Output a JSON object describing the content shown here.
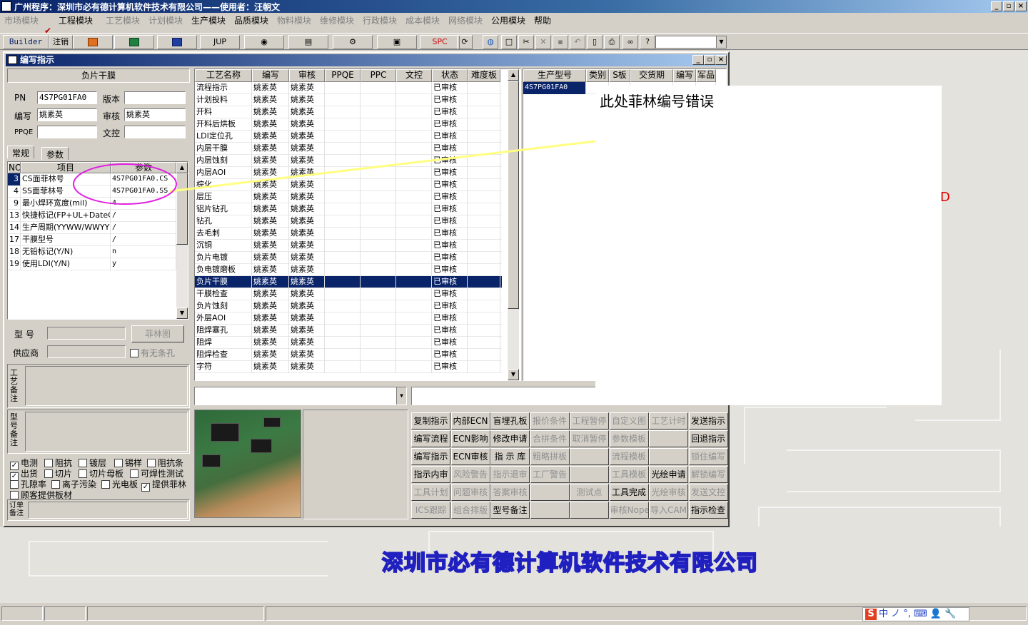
{
  "app": {
    "title": "广州程序：深圳市必有德计算机软件技术有限公司——使用者：汪朝文",
    "win_min": "_",
    "win_max": "▫",
    "win_close": "×"
  },
  "menu": [
    {
      "label": "市场模块",
      "enabled": false
    },
    {
      "label": "工程模块",
      "enabled": true,
      "checked": true
    },
    {
      "label": "工艺模块",
      "enabled": false
    },
    {
      "label": "计划模块",
      "enabled": false
    },
    {
      "label": "生产模块",
      "enabled": true
    },
    {
      "label": "品质模块",
      "enabled": true
    },
    {
      "label": "物料模块",
      "enabled": false
    },
    {
      "label": "维修模块",
      "enabled": false
    },
    {
      "label": "行政模块",
      "enabled": false
    },
    {
      "label": "成本模块",
      "enabled": false
    },
    {
      "label": "网络模块",
      "enabled": false
    },
    {
      "label": "公用模块",
      "enabled": true
    },
    {
      "label": "帮助",
      "enabled": true
    }
  ],
  "toolbar": {
    "builder": "Builder",
    "logout": "注销",
    "jup": "JUP",
    "spc": "SPC"
  },
  "child": {
    "title": "编写指示",
    "left": {
      "panel_title": "负片干膜",
      "pn_label": "PN",
      "pn_value": "4S7PG01FA0",
      "version_label": "版本",
      "version_value": "",
      "writer_label": "编写",
      "writer_value": "姚素英",
      "reviewer_label": "审核",
      "reviewer_value": "姚素英",
      "ppqe_label": "PPQE",
      "ppqe_value": "",
      "doc_label": "文控",
      "doc_value": "",
      "tab_general": "常规",
      "tab_params": "参数",
      "grid_headers": [
        "NO",
        "项目",
        "参数"
      ],
      "grid_rows": [
        {
          "no": "3",
          "item": "CS面菲林号",
          "param": "4S7PG01FA0.CS"
        },
        {
          "no": "4",
          "item": "SS面菲林号",
          "param": "4S7PG01FA0.SS"
        },
        {
          "no": "9",
          "item": "最小焊环宽度(mil)",
          "param": "4"
        },
        {
          "no": "13",
          "item": "快捷标记(FP+UL+DateC",
          "param": "/"
        },
        {
          "no": "14",
          "item": "生产周期(YYWW/WWYY)",
          "param": "/"
        },
        {
          "no": "17",
          "item": "干膜型号",
          "param": "/"
        },
        {
          "no": "18",
          "item": "无铅标记(Y/N)",
          "param": "n"
        },
        {
          "no": "19",
          "item": "使用LDI(Y/N)",
          "param": "y"
        }
      ],
      "model_label": "型  号",
      "model_value": "",
      "film_button": "菲林图",
      "supplier_label": "供应商",
      "supplier_value": "",
      "has_slot_label": "有无条孔",
      "process_note_label": "工艺备注",
      "model_note_label": "型号备注",
      "checkboxes": [
        {
          "label": "电测",
          "checked": true
        },
        {
          "label": "阻抗",
          "checked": false
        },
        {
          "label": "镀层",
          "checked": false
        },
        {
          "label": "锡样",
          "checked": false
        },
        {
          "label": "阻抗条",
          "checked": false
        },
        {
          "label": "出货",
          "checked": true
        },
        {
          "label": "切片",
          "checked": false
        },
        {
          "label": "切片母板",
          "checked": false
        },
        {
          "label": "可焊性测试",
          "checked": false
        },
        {
          "label": "孔隙率",
          "checked": false
        },
        {
          "label": "离子污染",
          "checked": false
        },
        {
          "label": "光电板",
          "checked": false
        },
        {
          "label": "提供菲林",
          "checked": true
        },
        {
          "label": "顾客提供板材",
          "checked": false
        }
      ],
      "order_note_label": "订单备注"
    },
    "process": {
      "headers": [
        "工艺名称",
        "编写",
        "审核",
        "PPQE",
        "PPC",
        "文控",
        "状态",
        "难度板"
      ],
      "rows": [
        [
          "流程指示",
          "姚素英",
          "姚素英",
          "",
          "",
          "",
          "已审核",
          ""
        ],
        [
          "计划投料",
          "姚素英",
          "姚素英",
          "",
          "",
          "",
          "已审核",
          ""
        ],
        [
          "开料",
          "姚素英",
          "姚素英",
          "",
          "",
          "",
          "已审核",
          ""
        ],
        [
          "开料后烘板",
          "姚素英",
          "姚素英",
          "",
          "",
          "",
          "已审核",
          ""
        ],
        [
          "LDI定位孔",
          "姚素英",
          "姚素英",
          "",
          "",
          "",
          "已审核",
          ""
        ],
        [
          "内层干膜",
          "姚素英",
          "姚素英",
          "",
          "",
          "",
          "已审核",
          ""
        ],
        [
          "内层蚀刻",
          "姚素英",
          "姚素英",
          "",
          "",
          "",
          "已审核",
          ""
        ],
        [
          "内层AOI",
          "姚素英",
          "姚素英",
          "",
          "",
          "",
          "已审核",
          ""
        ],
        [
          "棕化",
          "姚素英",
          "姚素英",
          "",
          "",
          "",
          "已审核",
          ""
        ],
        [
          "层压",
          "姚素英",
          "姚素英",
          "",
          "",
          "",
          "已审核",
          ""
        ],
        [
          "铝片钻孔",
          "姚素英",
          "姚素英",
          "",
          "",
          "",
          "已审核",
          ""
        ],
        [
          "钻孔",
          "姚素英",
          "姚素英",
          "",
          "",
          "",
          "已审核",
          ""
        ],
        [
          "去毛刺",
          "姚素英",
          "姚素英",
          "",
          "",
          "",
          "已审核",
          ""
        ],
        [
          "沉铜",
          "姚素英",
          "姚素英",
          "",
          "",
          "",
          "已审核",
          ""
        ],
        [
          "负片电镀",
          "姚素英",
          "姚素英",
          "",
          "",
          "",
          "已审核",
          ""
        ],
        [
          "负电镀磨板",
          "姚素英",
          "姚素英",
          "",
          "",
          "",
          "已审核",
          ""
        ],
        [
          "负片干膜",
          "姚素英",
          "姚素英",
          "",
          "",
          "",
          "已审核",
          ""
        ],
        [
          "干膜检查",
          "姚素英",
          "姚素英",
          "",
          "",
          "",
          "已审核",
          ""
        ],
        [
          "负片蚀刻",
          "姚素英",
          "姚素英",
          "",
          "",
          "",
          "已审核",
          ""
        ],
        [
          "外层AOI",
          "姚素英",
          "姚素英",
          "",
          "",
          "",
          "已审核",
          ""
        ],
        [
          "阻焊塞孔",
          "姚素英",
          "姚素英",
          "",
          "",
          "",
          "已审核",
          ""
        ],
        [
          "阻焊",
          "姚素英",
          "姚素英",
          "",
          "",
          "",
          "已审核",
          ""
        ],
        [
          "阻焊检查",
          "姚素英",
          "姚素英",
          "",
          "",
          "",
          "已审核",
          ""
        ],
        [
          "字符",
          "姚素英",
          "姚素英",
          "",
          "",
          "",
          "已审核",
          ""
        ]
      ],
      "selected_index": 16
    },
    "orders": {
      "headers": [
        "生产型号",
        "类别",
        "S板",
        "交货期",
        "编写",
        "军品"
      ],
      "rows": [
        [
          "4S7PG01FA0",
          "",
          "",
          "",
          "",
          ""
        ]
      ]
    },
    "buttons": [
      [
        {
          "l": "复制指示",
          "e": true
        },
        {
          "l": "内部ECN",
          "e": true
        },
        {
          "l": "盲埋孔板",
          "e": true
        },
        {
          "l": "报价条件",
          "e": false
        },
        {
          "l": "工程暂停",
          "e": false
        },
        {
          "l": "自定义图",
          "e": false
        },
        {
          "l": "工艺计时",
          "e": false
        },
        {
          "l": "发送指示",
          "e": true
        }
      ],
      [
        {
          "l": "编写流程",
          "e": true
        },
        {
          "l": "ECN影响",
          "e": true
        },
        {
          "l": "修改申请",
          "e": true
        },
        {
          "l": "合拼条件",
          "e": false
        },
        {
          "l": "取消暂停",
          "e": false
        },
        {
          "l": "参数模板",
          "e": false
        },
        {
          "l": "",
          "e": false
        },
        {
          "l": "回退指示",
          "e": true
        }
      ],
      [
        {
          "l": "编写指示",
          "e": true
        },
        {
          "l": "ECN审核",
          "e": true
        },
        {
          "l": "指 示 库",
          "e": true
        },
        {
          "l": "粗略拼板",
          "e": false
        },
        {
          "l": "",
          "e": false
        },
        {
          "l": "流程模板",
          "e": false
        },
        {
          "l": "",
          "e": false
        },
        {
          "l": "锁住编写",
          "e": false
        }
      ],
      [
        {
          "l": "指示内审",
          "e": true
        },
        {
          "l": "风险警告",
          "e": false
        },
        {
          "l": "指示退审",
          "e": false
        },
        {
          "l": "工厂警告",
          "e": false
        },
        {
          "l": "",
          "e": false
        },
        {
          "l": "工具模板",
          "e": false
        },
        {
          "l": "光绘申请",
          "e": true
        },
        {
          "l": "解锁编写",
          "e": false
        }
      ],
      [
        {
          "l": "工具计划",
          "e": false
        },
        {
          "l": "问题审核",
          "e": false
        },
        {
          "l": "答案审核",
          "e": false
        },
        {
          "l": "",
          "e": false
        },
        {
          "l": "测试点",
          "e": false
        },
        {
          "l": "工具完成",
          "e": true
        },
        {
          "l": "光绘审核",
          "e": false
        },
        {
          "l": "发送文控",
          "e": false
        }
      ],
      [
        {
          "l": "ICS跟踪",
          "e": false
        },
        {
          "l": "组合排版",
          "e": false
        },
        {
          "l": "型号备注",
          "e": true
        },
        {
          "l": "",
          "e": false
        },
        {
          "l": "",
          "e": false
        },
        {
          "l": "审核Nope",
          "e": false
        },
        {
          "l": "导入CAM",
          "e": false
        },
        {
          "l": "指示检查",
          "e": true
        }
      ]
    ]
  },
  "annotation": {
    "text": "此处菲林编号错误",
    "red_mark": "D"
  },
  "background": {
    "slogan": "深圳市必有德计算机软件技术有限公司"
  },
  "ime": {
    "text": "中 ノ °, ⌨ 👤 🔧"
  },
  "colors": {
    "titlebar": "#0a246a",
    "selection": "#0a246a",
    "annotation_line": "#ffff80",
    "annotation_ellipse": "#e020e0",
    "slogan": "#2020c0"
  }
}
